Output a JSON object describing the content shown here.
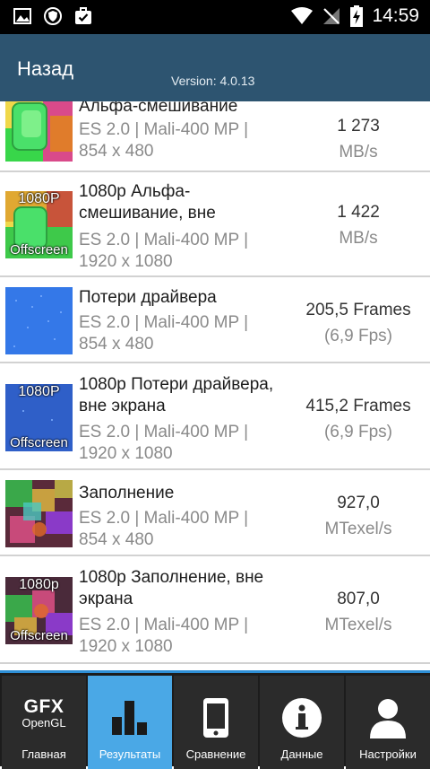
{
  "status_bar": {
    "time": "14:59"
  },
  "header": {
    "back_label": "Назад",
    "version": "Version: 4.0.13"
  },
  "results": [
    {
      "title": "Альфа-смешивание",
      "api": "ES 2.0 | Mali-400 MP |",
      "resolution": "854 x 480",
      "value": "1 273",
      "unit": "MB/s",
      "thumb": "alpha-blend-thumbnail",
      "thumb_top": "",
      "thumb_bottom": ""
    },
    {
      "title": "1080p Альфа-смешивание, вне",
      "api": "ES 2.0 | Mali-400 MP |",
      "resolution": "1920 x 1080",
      "value": "1 422",
      "unit": "MB/s",
      "thumb": "alpha-blend-offscreen-thumbnail",
      "thumb_top": "1080P",
      "thumb_bottom": "Offscreen"
    },
    {
      "title": "Потери драйвера",
      "api": "ES 2.0 | Mali-400 MP |",
      "resolution": "854 x 480",
      "value": "205,5 Frames",
      "unit": "(6,9 Fps)",
      "thumb": "driver-overhead-thumbnail",
      "thumb_top": "",
      "thumb_bottom": ""
    },
    {
      "title": "1080p Потери драйвера, вне экрана",
      "api": "ES 2.0 | Mali-400 MP |",
      "resolution": "1920 x 1080",
      "value": "415,2 Frames",
      "unit": "(6,9 Fps)",
      "thumb": "driver-overhead-offscreen-thumbnail",
      "thumb_top": "1080P",
      "thumb_bottom": "Offscreen"
    },
    {
      "title": "Заполнение",
      "api": "ES 2.0 | Mali-400 MP |",
      "resolution": "854 x 480",
      "value": "927,0",
      "unit": "MTexel/s",
      "thumb": "fill-rate-thumbnail",
      "thumb_top": "",
      "thumb_bottom": ""
    },
    {
      "title": "1080p Заполнение, вне экрана",
      "api": "ES 2.0 | Mali-400 MP |",
      "resolution": "1920 x 1080",
      "value": "807,0",
      "unit": "MTexel/s",
      "thumb": "fill-rate-offscreen-thumbnail",
      "thumb_top": "1080p",
      "thumb_bottom": "Offscreen"
    }
  ],
  "nav": {
    "home": {
      "logo_big": "GFX",
      "logo_small": "OpenGL",
      "label": "Главная"
    },
    "results": {
      "label": "Результаты",
      "icon": "bar-chart-icon"
    },
    "compare": {
      "label": "Сравнение",
      "icon": "phone-icon"
    },
    "info": {
      "label": "Данные",
      "icon": "info-icon"
    },
    "settings": {
      "label": "Настройки",
      "icon": "user-icon"
    },
    "active": "results"
  },
  "colors": {
    "header": "#2d5470",
    "nav_active": "#4aa8e6",
    "nav_accent": "#2e8fd6"
  }
}
